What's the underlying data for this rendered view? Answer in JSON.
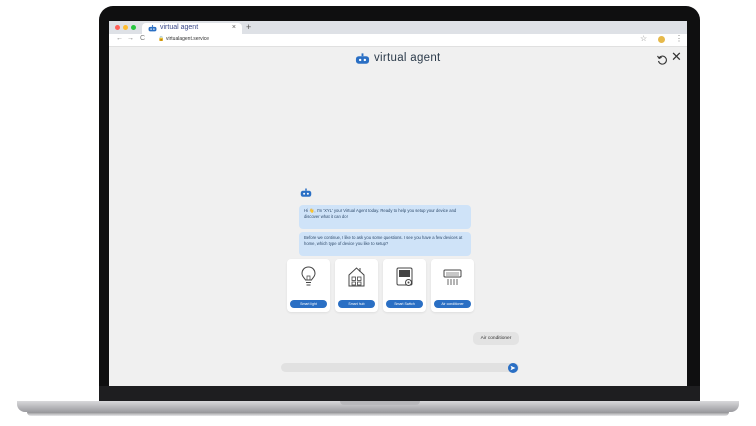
{
  "browser": {
    "tab_title": "virtual agent",
    "tab_close": "×",
    "new_tab": "+",
    "url": "virtualagent.service",
    "nav_back": "←",
    "nav_forward": "→",
    "nav_reload": "C",
    "lock": "🔒",
    "star": "☆",
    "menu": "⋮",
    "traffic_colors": [
      "#ff5f57",
      "#febc2e",
      "#28c840"
    ]
  },
  "app": {
    "title": "virtual agent",
    "brand_color": "#2a6fc4",
    "reset_icon": "reset-icon",
    "close_label": "✕"
  },
  "chat": {
    "messages": [
      {
        "from": "bot",
        "text": "Hi 👋, I'm 'XYL' your Virtual Agent today. Ready to help you setup your device and discover what it can do!"
      },
      {
        "from": "bot",
        "text": "Before we continue, I like to ask you some questions. I see you have a few devices at home, which type of device you like to setup?"
      }
    ],
    "options": [
      {
        "icon": "lightbulb-icon",
        "label": "Smart light"
      },
      {
        "icon": "smart-hub-icon",
        "label": "Smart hub"
      },
      {
        "icon": "smart-switch-icon",
        "label": "Smart Switch"
      },
      {
        "icon": "air-conditioner-icon",
        "label": "Air conditioner"
      }
    ],
    "user_reply": "Air conditioner",
    "input_placeholder": ""
  }
}
